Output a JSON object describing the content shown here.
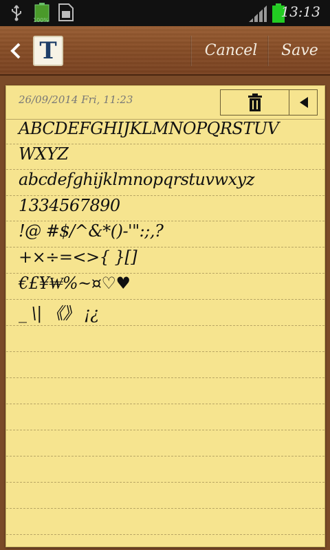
{
  "status_bar": {
    "time": "13:13",
    "battery_small_label": "100%"
  },
  "titlebar": {
    "back_icon": "chevron-left-icon",
    "app_icon_letter": "T",
    "cancel_label": "Cancel",
    "save_label": "Save"
  },
  "note": {
    "date": "26/09/2014 Fri, 11:23",
    "lines": [
      "ABCDEFGHIJKLMNOPQRSTUV",
      "WXYZ",
      "abcdefghijklmnopqrstuvwxyz",
      "1334567890",
      "!@ #$/^&*()-'\":;,?",
      "+×÷=<>{ }[]",
      "€£¥₩%~¤♡♥",
      "_ \\| 《》 ¡¿"
    ]
  }
}
